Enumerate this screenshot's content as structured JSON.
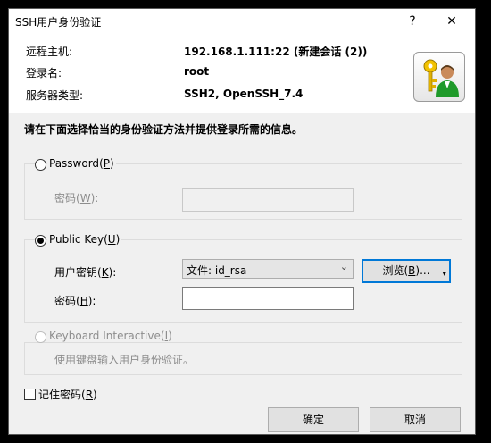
{
  "window": {
    "title": "SSH用户身份验证",
    "help_label": "?",
    "close_label": "✕"
  },
  "header": {
    "host_label": "远程主机:",
    "host_value": "192.168.1.111:22 (新建会话 (2))",
    "login_label": "登录名:",
    "login_value": "root",
    "server_label": "服务器类型:",
    "server_value": "SSH2, OpenSSH_7.4",
    "icon": "key-user-icon"
  },
  "instruction": "请在下面选择恰当的身份验证方法并提供登录所需的信息。",
  "password_group": {
    "label": "Password",
    "accel": "P",
    "password_label": "密码",
    "password_accel": "W"
  },
  "pubkey_group": {
    "label": "Public Key",
    "accel": "U",
    "key_label": "用户密钥",
    "key_accel": "K",
    "key_value": "文件: id_rsa",
    "browse_label": "浏览",
    "browse_accel": "B",
    "passphrase_label": "密码",
    "passphrase_accel": "H"
  },
  "keyboard_group": {
    "label": "Keyboard Interactive",
    "accel": "I",
    "description": "使用键盘输入用户身份验证。"
  },
  "remember": {
    "label": "记住密码",
    "accel": "R"
  },
  "buttons": {
    "ok": "确定",
    "cancel": "取消"
  }
}
